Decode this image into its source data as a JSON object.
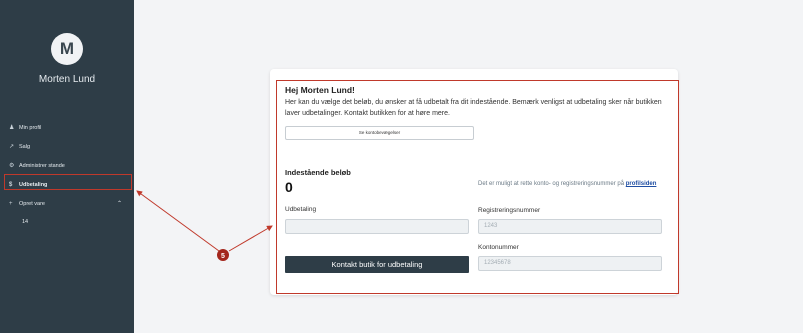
{
  "sidebar": {
    "avatar_initial": "M",
    "user_name": "Morten Lund",
    "items": [
      {
        "icon": "person-icon",
        "glyph": "♟",
        "label": "Min profil"
      },
      {
        "icon": "trending-icon",
        "glyph": "↗",
        "label": "Salg"
      },
      {
        "icon": "gear-icon",
        "glyph": "⚙",
        "label": "Administrer stande"
      },
      {
        "icon": "dollar-icon",
        "glyph": "$",
        "label": "Udbetaling"
      },
      {
        "icon": "plus-icon",
        "glyph": "+",
        "label": "Opret vare"
      }
    ],
    "chevron": "⌃",
    "sub_items": [
      "14"
    ]
  },
  "card": {
    "greeting": "Hej Morten Lund!",
    "intro": "Her kan du vælge det beløb, du ønsker at få udbetalt fra dit indestående. Bemærk venligst at udbetaling sker når butikken laver udbetalinger. Kontakt butikken for at høre mere.",
    "history_button": "Se kontobevægelser",
    "balance_label": "Indestående beløb",
    "balance_value": "0",
    "info_text": "Det er muligt at rette konto- og registreringsnummer på",
    "info_link": "profilsiden",
    "payout_label": "Udbetaling",
    "payout_value": "",
    "reg_label": "Registreringsnummer",
    "reg_placeholder": "1243",
    "account_label": "Kontonummer",
    "account_placeholder": "12345678",
    "contact_button": "Kontakt butik for udbetaling"
  },
  "annotation": {
    "marker_number": "5",
    "color": "#c0392b"
  }
}
